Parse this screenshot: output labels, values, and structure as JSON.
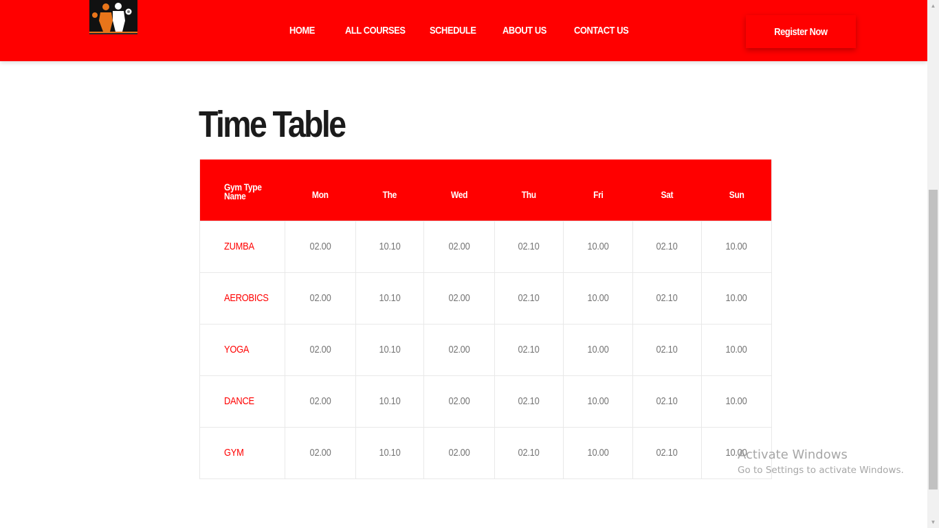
{
  "header": {
    "logo_icon": "gym-logo-icon",
    "nav": [
      {
        "label": "HOME"
      },
      {
        "label": "ALL COURSES"
      },
      {
        "label": "SCHEDULE"
      },
      {
        "label": "ABOUT US"
      },
      {
        "label": "CONTACT US"
      }
    ],
    "register_label": "Register Now",
    "background_color": "#ff0000"
  },
  "page_title": "Time Table",
  "timetable": {
    "header_color": "#ff0000",
    "first_column_label_line1": "Gym Type",
    "first_column_label_line2": "Name",
    "days": [
      "Mon",
      "The",
      "Wed",
      "Thu",
      "Fri",
      "Sat",
      "Sun"
    ],
    "rows": [
      {
        "name": "ZUMBA",
        "times": [
          "02.00",
          "10.10",
          "02.00",
          "02.10",
          "10.00",
          "02.10",
          "10.00"
        ]
      },
      {
        "name": "AEROBICS",
        "times": [
          "02.00",
          "10.10",
          "02.00",
          "02.10",
          "10.00",
          "02.10",
          "10.00"
        ]
      },
      {
        "name": "YOGA",
        "times": [
          "02.00",
          "10.10",
          "02.00",
          "02.10",
          "10.00",
          "02.10",
          "10.00"
        ]
      },
      {
        "name": "DANCE",
        "times": [
          "02.00",
          "10.10",
          "02.00",
          "02.10",
          "10.00",
          "02.10",
          "10.00"
        ]
      },
      {
        "name": "GYM",
        "times": [
          "02.00",
          "10.10",
          "02.00",
          "02.10",
          "10.00",
          "02.10",
          "10.00"
        ]
      }
    ]
  },
  "watermark": {
    "line1": "Activate Windows",
    "line2": "Go to Settings to activate Windows."
  }
}
